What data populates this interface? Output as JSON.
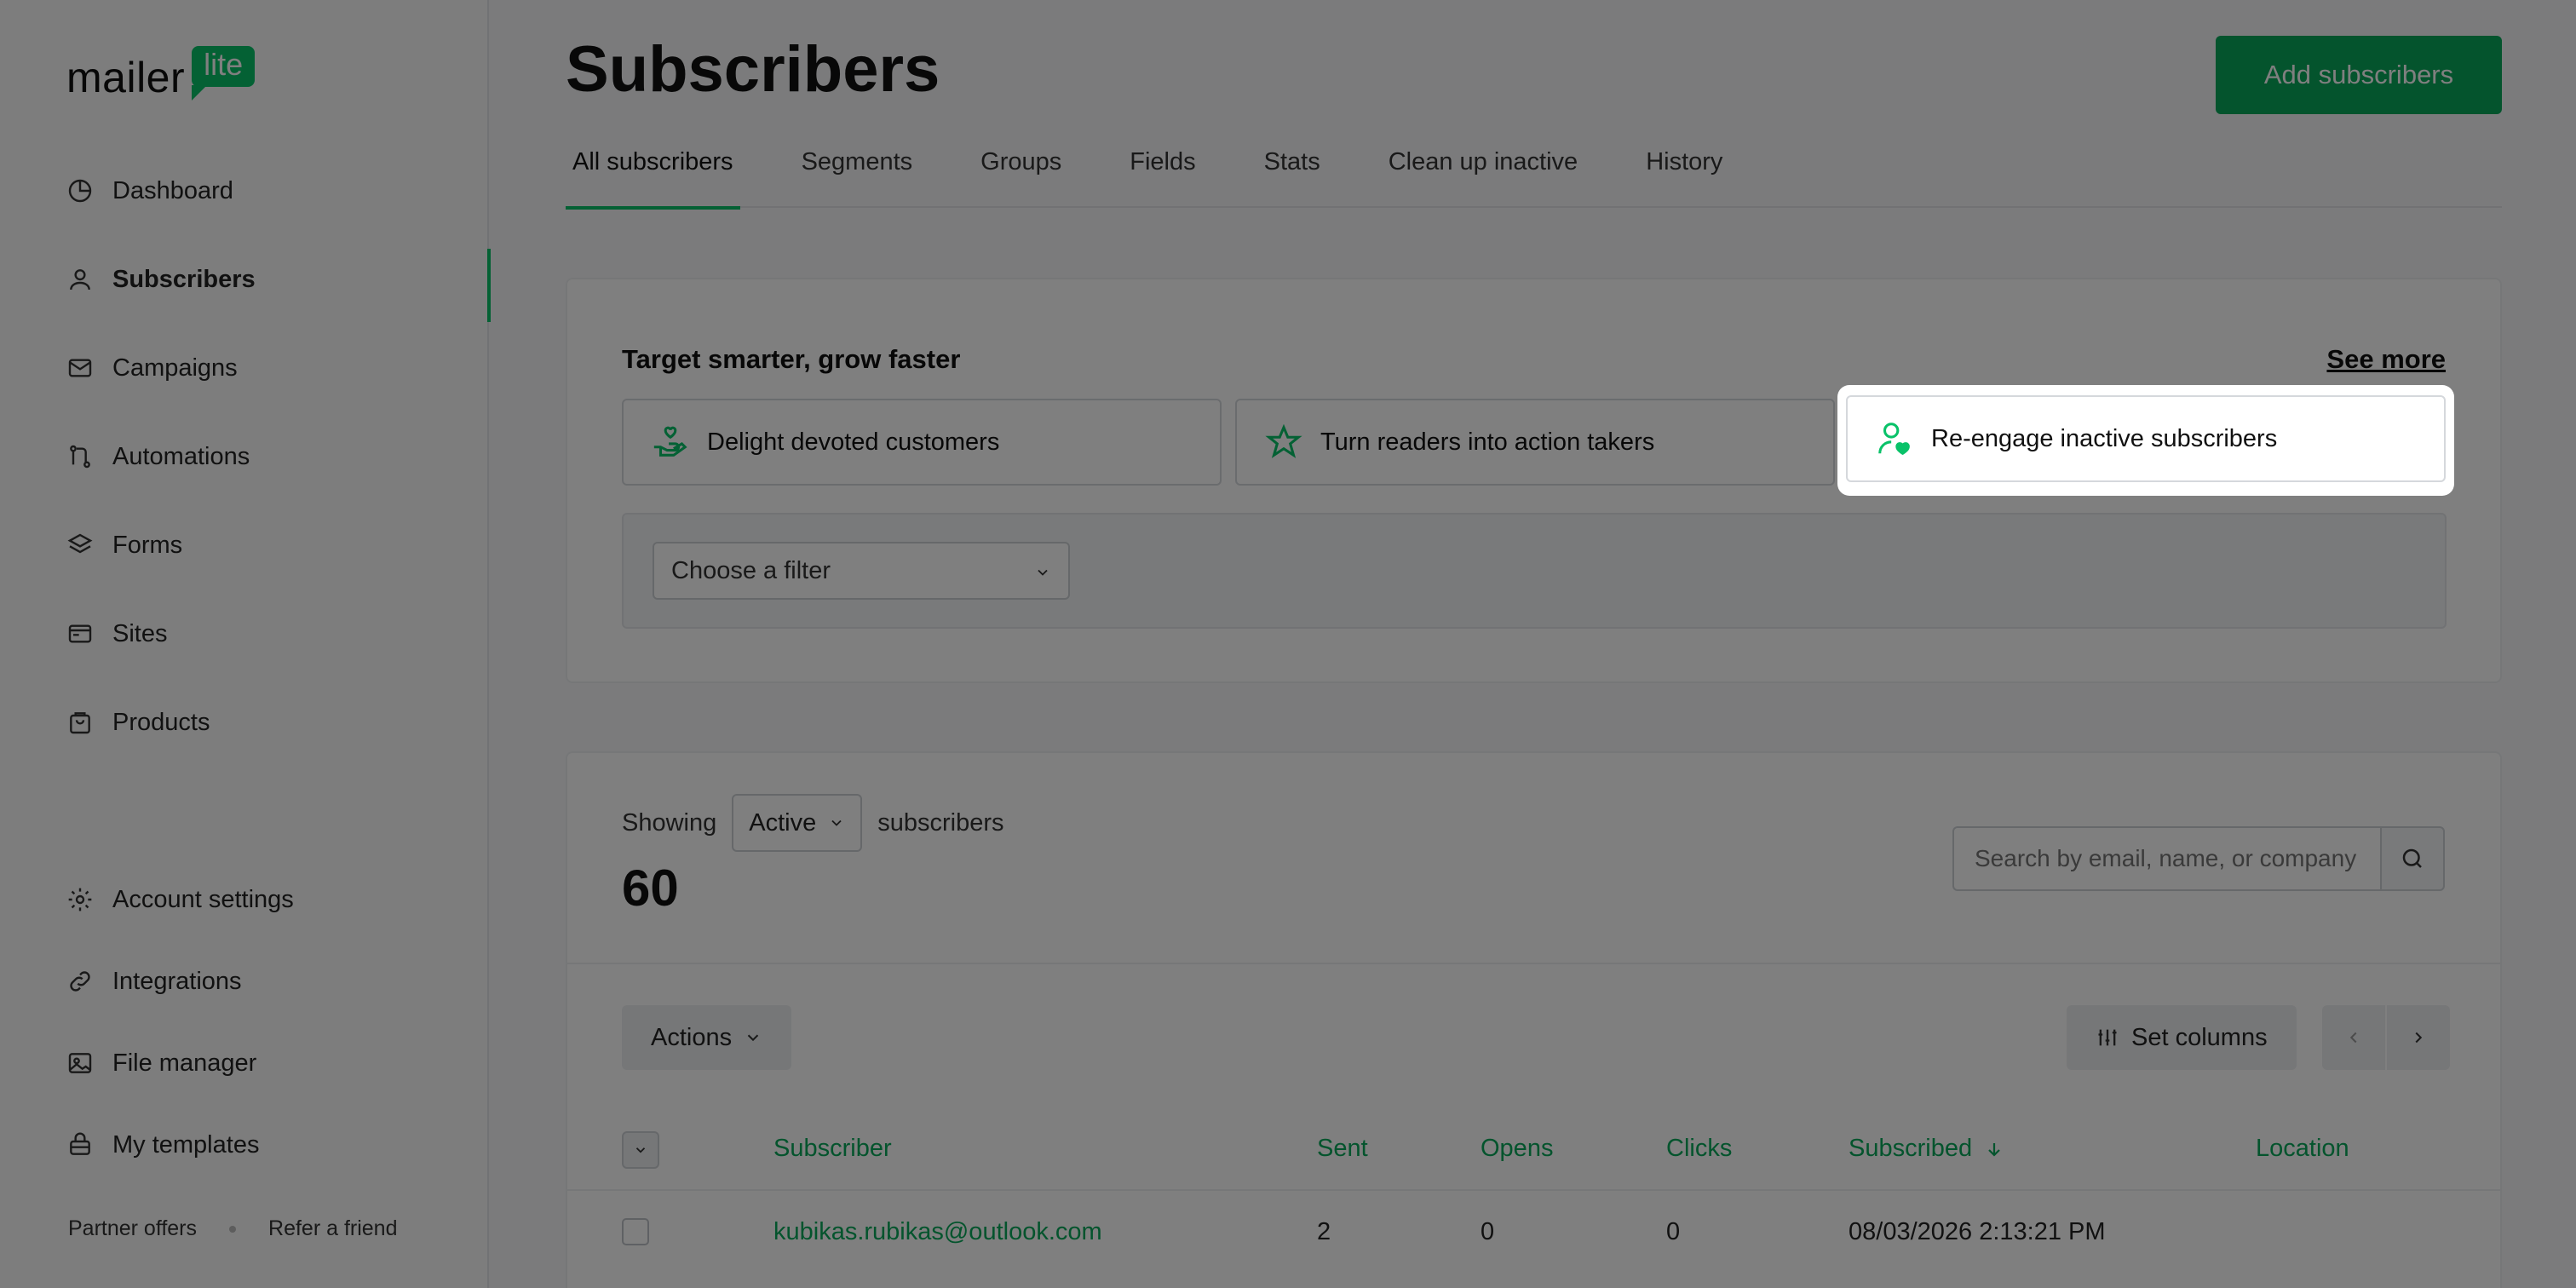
{
  "brand": {
    "word": "mailer",
    "badge": "lite"
  },
  "sidebar": {
    "items": [
      {
        "label": "Dashboard",
        "icon": "dashboard-icon"
      },
      {
        "label": "Subscribers",
        "icon": "user-icon",
        "active": true
      },
      {
        "label": "Campaigns",
        "icon": "mail-icon"
      },
      {
        "label": "Automations",
        "icon": "automation-icon"
      },
      {
        "label": "Forms",
        "icon": "layers-icon"
      },
      {
        "label": "Sites",
        "icon": "browser-icon"
      },
      {
        "label": "Products",
        "icon": "bag-icon"
      }
    ],
    "bottom_items": [
      {
        "label": "Account settings",
        "icon": "gear-icon"
      },
      {
        "label": "Integrations",
        "icon": "link-icon"
      },
      {
        "label": "File manager",
        "icon": "image-icon"
      },
      {
        "label": "My templates",
        "icon": "template-icon"
      }
    ],
    "footer": {
      "partner": "Partner offers",
      "refer": "Refer a friend"
    }
  },
  "header": {
    "title": "Subscribers",
    "add_button": "Add subscribers",
    "tabs": [
      "All subscribers",
      "Segments",
      "Groups",
      "Fields",
      "Stats",
      "Clean up inactive",
      "History"
    ],
    "active_tab": "All subscribers"
  },
  "promo": {
    "title": "Target smarter, grow faster",
    "see_more": "See more",
    "tiles": [
      {
        "label": "Delight devoted customers",
        "icon": "hand-heart-icon"
      },
      {
        "label": "Turn readers into action takers",
        "icon": "star-icon"
      },
      {
        "label": "Re-engage inactive subscribers",
        "icon": "user-heart-icon",
        "highlighted": true
      }
    ],
    "filter_placeholder": "Choose a filter"
  },
  "list": {
    "showing_prefix": "Showing",
    "status": "Active",
    "showing_suffix": "subscribers",
    "count": "60",
    "search_placeholder": "Search by email, name, or company",
    "actions_label": "Actions",
    "set_columns_label": "Set columns",
    "columns": [
      "Subscriber",
      "Sent",
      "Opens",
      "Clicks",
      "Subscribed",
      "Location"
    ],
    "rows": [
      {
        "subscriber": "kubikas.rubikas@outlook.com",
        "sent": "2",
        "opens": "0",
        "clicks": "0",
        "subscribed": "08/03/2026 2:13:21 PM",
        "location": ""
      }
    ]
  },
  "colors": {
    "accent": "#09c269",
    "accent_dark": "#09a85a"
  }
}
